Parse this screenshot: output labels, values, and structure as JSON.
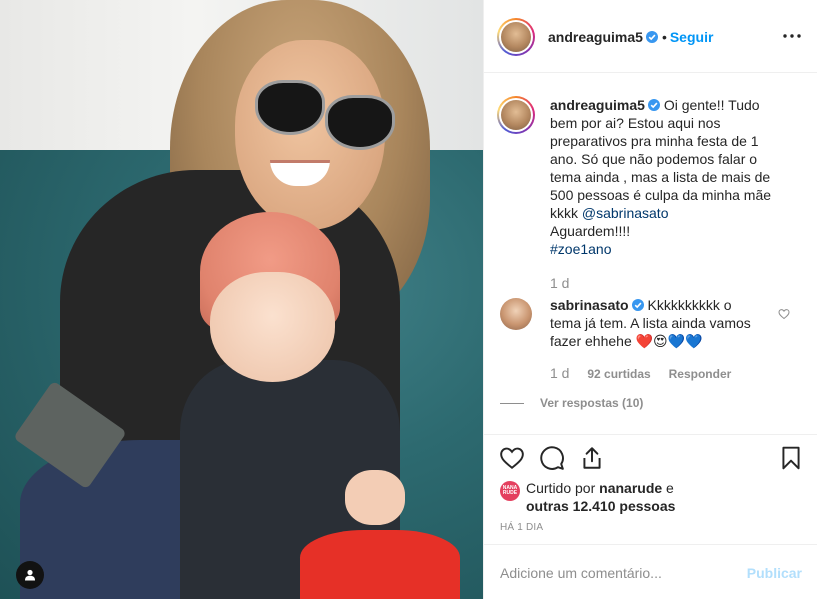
{
  "post": {
    "author": "andreaguima5",
    "follow_label": "Seguir",
    "dot": "•",
    "caption_lines": [
      "Oi gente!! Tudo",
      "bem por ai? Estou aqui nos",
      "preparativos pra minha festa de 1",
      "ano. Só que não podemos falar o",
      "tema ainda , mas a lista de mais de",
      "500 pessoas é culpa da minha mãe",
      "kkkk"
    ],
    "mention": "@sabrinasato",
    "caption_tail": "Aguardem!!!!",
    "hashtag": "#zoe1ano",
    "caption_age": "1 d"
  },
  "comment": {
    "author": "sabrinasato",
    "text_line1": "Kkkkkkkkkk o",
    "text_line2": "tema já tem. A lista ainda vamos",
    "text_line3": "fazer ehhehe",
    "emoji": "❤️😍💙💙",
    "age": "1 d",
    "likes": "92 curtidas",
    "reply": "Responder",
    "view_replies": "Ver respostas (10)"
  },
  "likes": {
    "liker_badge_line1": "NANA",
    "liker_badge_line2": "RUDE",
    "prefix": "Curtido por ",
    "liker": "nanarude",
    "middle": " e",
    "others": "outras 12.410 pessoas",
    "timestamp": "HÁ 1 DIA"
  },
  "composer": {
    "placeholder": "Adicione um comentário...",
    "post_label": "Publicar"
  },
  "colors": {
    "link": "#0095f6",
    "hashtag": "#00376b",
    "muted": "#8e8e8e"
  }
}
